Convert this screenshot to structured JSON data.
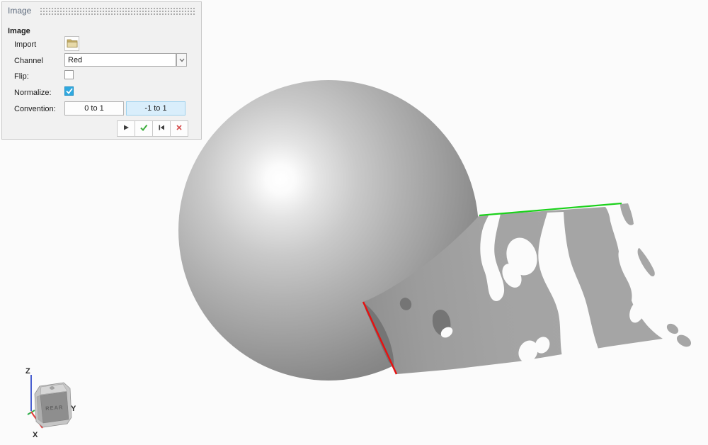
{
  "panel": {
    "title": "Image",
    "section_header": "Image",
    "fields": {
      "import": {
        "label": "Import",
        "icon": "folder-open-icon"
      },
      "channel": {
        "label": "Channel",
        "value": "Red",
        "icon": "chevron-down-icon"
      },
      "flip": {
        "label": "Flip:",
        "checked": false
      },
      "normalize": {
        "label": "Normalize:",
        "checked": true,
        "accent_color": "#2fa8df"
      },
      "convention": {
        "label": "Convention:",
        "options": [
          "0 to 1",
          "-1 to 1"
        ],
        "selected_index": 1,
        "selected": "-1 to 1",
        "selected_bg": "#d9eefb"
      }
    },
    "action_icons": [
      "play-icon",
      "confirm-check-icon",
      "skip-to-start-icon",
      "cancel-x-icon"
    ]
  },
  "viewport": {
    "scene": {
      "objects": [
        "sphere",
        "image-mapped-plane"
      ],
      "plane_color": "#a4a4a4",
      "u_edge_color": "#1bd11b",
      "v_edge_color": "#e51212"
    },
    "viewcube": {
      "face_label": "REAR",
      "axes": {
        "z": "Z",
        "y": "Y",
        "x": "X"
      },
      "axis_colors": {
        "z": "#4a5fd0",
        "x": "#e23b3b",
        "y": "#2fae4a"
      }
    }
  }
}
